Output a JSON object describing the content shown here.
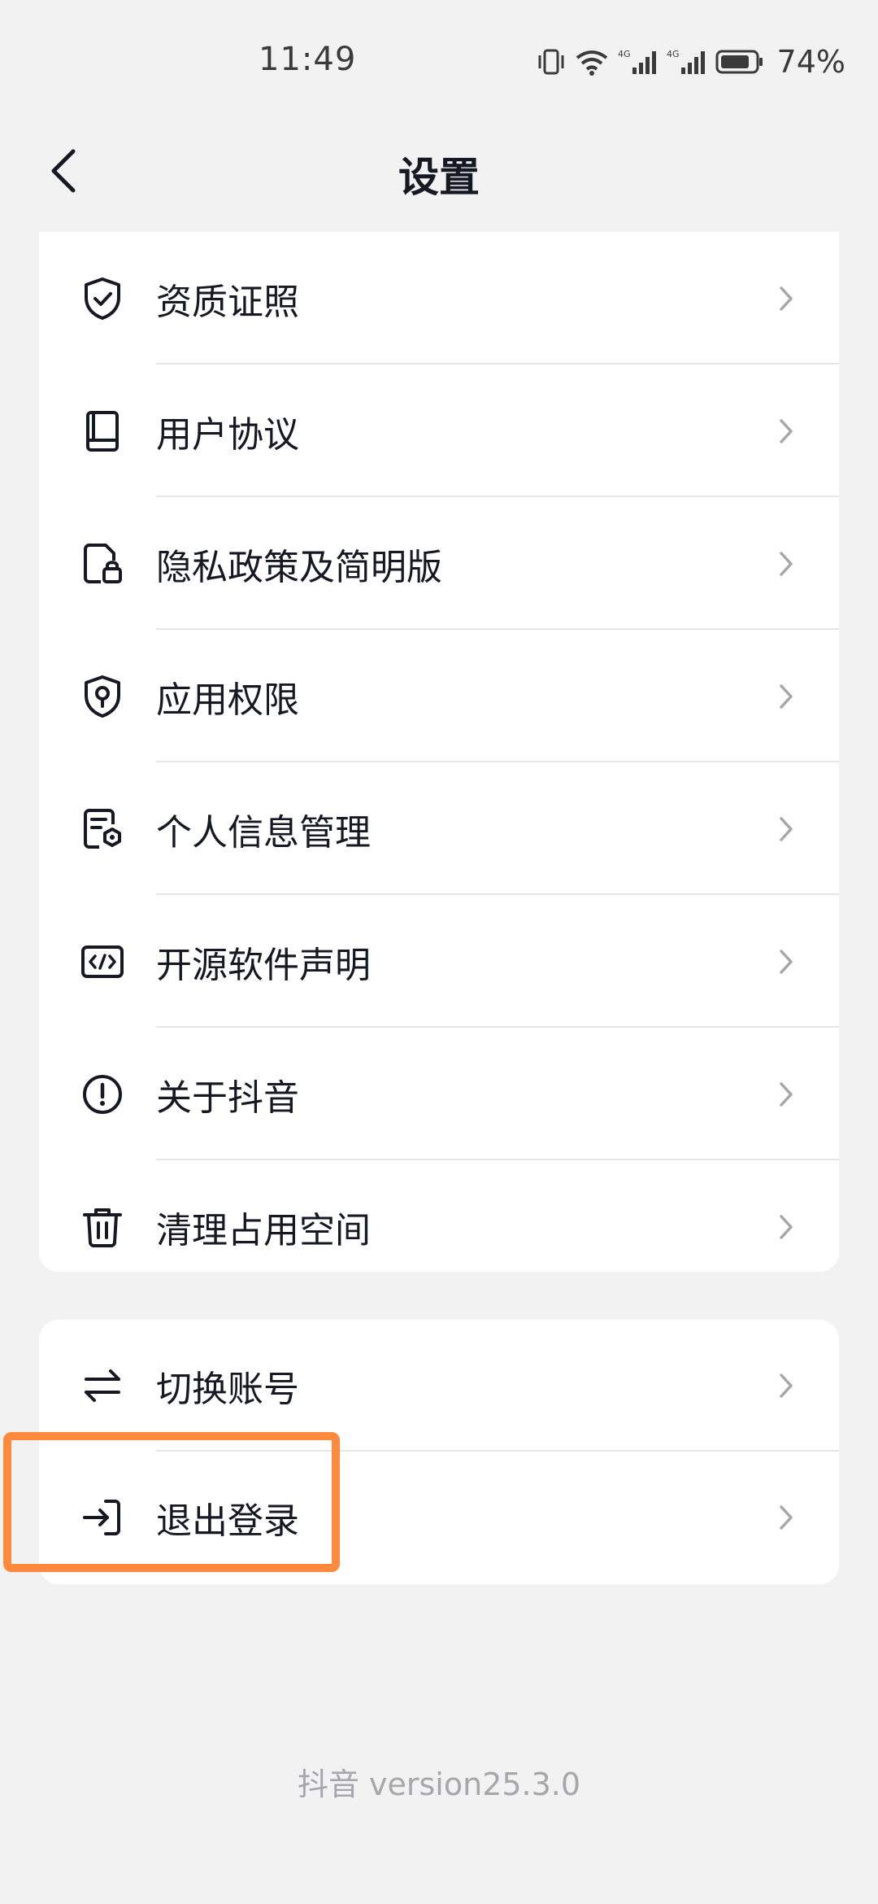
{
  "status_bar": {
    "time": "11:49",
    "battery_percent": "74%",
    "icons": [
      "vibrate-icon",
      "wifi-icon",
      "signal-4g-icon",
      "signal-4g-icon",
      "battery-icon"
    ]
  },
  "nav": {
    "title": "设置",
    "back_icon": "back-arrow-icon"
  },
  "settings_items": [
    {
      "label": "资质证照",
      "icon": "shield-check-icon"
    },
    {
      "label": "用户协议",
      "icon": "book-icon"
    },
    {
      "label": "隐私政策及简明版",
      "icon": "document-lock-icon"
    },
    {
      "label": "应用权限",
      "icon": "shield-location-icon"
    },
    {
      "label": "个人信息管理",
      "icon": "document-gear-icon"
    },
    {
      "label": "开源软件声明",
      "icon": "code-icon"
    },
    {
      "label": "关于抖音",
      "icon": "info-circle-icon"
    },
    {
      "label": "清理占用空间",
      "icon": "trash-icon"
    }
  ],
  "account_items": [
    {
      "label": "切换账号",
      "icon": "swap-arrows-icon"
    },
    {
      "label": "退出登录",
      "icon": "logout-icon"
    }
  ],
  "version": "抖音 version25.3.0",
  "colors": {
    "background": "#f2f2f2",
    "card": "#ffffff",
    "text": "#161823",
    "secondary_text": "#a7a7ab",
    "highlight": "#ff8a3d"
  }
}
